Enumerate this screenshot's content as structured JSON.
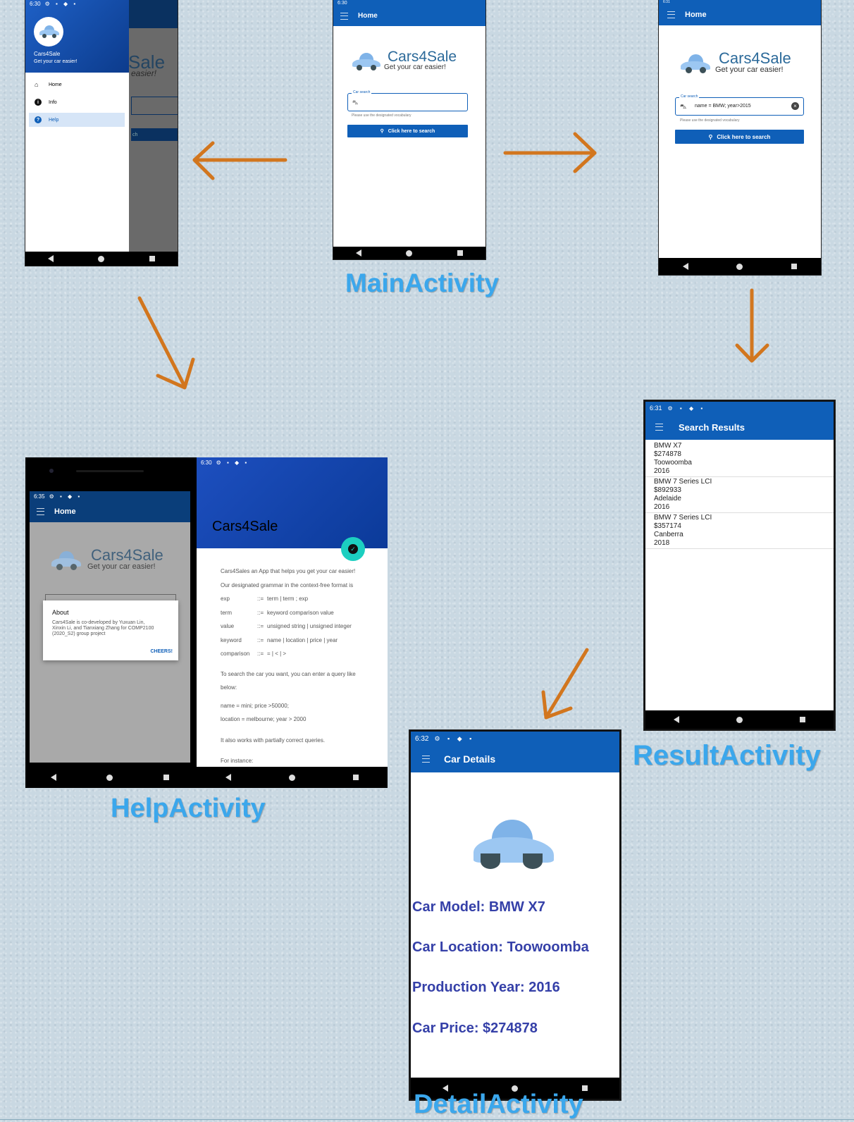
{
  "labels": {
    "main": "MainActivity",
    "result": "ResultActivity",
    "help": "HelpActivity",
    "detail": "DetailActivity"
  },
  "logo": {
    "title": "Cars4Sale",
    "tagline": "Get your car easier!"
  },
  "drawer_screen": {
    "status_time": "6:30",
    "app_name": "Cars4Sale",
    "tagline": "Get your car easier!",
    "items": [
      {
        "label": "Home",
        "icon": "home-icon"
      },
      {
        "label": "Info",
        "icon": "info-icon"
      },
      {
        "label": "Help",
        "icon": "help-icon"
      }
    ],
    "bg_logo_text": "Sale",
    "bg_logo_sub": "easier!",
    "bg_button_text": "ch"
  },
  "main_screen": {
    "status_time": "6:30",
    "title": "Home",
    "search_label": "Car search",
    "hint": "Please use the designated vocabulary",
    "button": "Click here to search"
  },
  "search_screen": {
    "status_time": "6:31",
    "title": "Home",
    "search_label": "Car search",
    "query": "name = BMW; year>2015",
    "hint": "Please use the designated vocabulary",
    "button": "Click here to search"
  },
  "result_screen": {
    "status_time": "6:31",
    "title": "Search Results",
    "results": [
      {
        "name": "BMW X7",
        "price": "$274878",
        "location": "Toowoomba",
        "year": "2016"
      },
      {
        "name": "BMW 7 Series LCI",
        "price": "$892933",
        "location": "Adelaide",
        "year": "2016"
      },
      {
        "name": "BMW 7 Series LCI",
        "price": "$357174",
        "location": "Canberra",
        "year": "2018"
      }
    ]
  },
  "about_screen": {
    "status_time": "6:35",
    "title": "Home",
    "dialog_title": "About",
    "dialog_body": "Cars4Sale is co-developed by Yuxuan Lin, Xinxin Li, and Tianxiang Zhang for COMP2100 (2020_S2) group project",
    "dialog_button": "CHEERS!"
  },
  "help_screen": {
    "status_time": "6:30",
    "header_title": "Cars4Sale",
    "intro": "Cars4Sales an App that helps you get your car easier!",
    "grammar_intro": "Our designated grammar in the context-free format is",
    "grammar": [
      {
        "term": "exp",
        "sep": "::=",
        "def": "term | term ; exp"
      },
      {
        "term": "term",
        "sep": "::=",
        "def": "keyword comparison value"
      },
      {
        "term": "value",
        "sep": "::=",
        "def": "unsigned string | unsigned integer"
      },
      {
        "term": "keyword",
        "sep": "::=",
        "def": "name | location | price | year"
      },
      {
        "term": "comparison",
        "sep": "::=",
        "def": "= | < | >"
      }
    ],
    "search_intro": "To search the car you want, you can enter a query like below:",
    "example1": "name = mini; price >50000;",
    "example2": "location = melbourne; year > 2000",
    "partial": "It also works with partially correct queries.",
    "for_instance": "For instance:"
  },
  "detail_screen": {
    "status_time": "6:32",
    "title": "Car Details",
    "model": "Car Model: BMW X7",
    "location": "Car Location: Toowoomba",
    "year": "Production Year: 2016",
    "price": "Car Price: $274878"
  },
  "colors": {
    "primary": "#0f5fb8",
    "label": "#3ba7ec",
    "arrow": "#d2761e",
    "detail_text": "#3540a8",
    "fab": "#1ccfc0"
  }
}
